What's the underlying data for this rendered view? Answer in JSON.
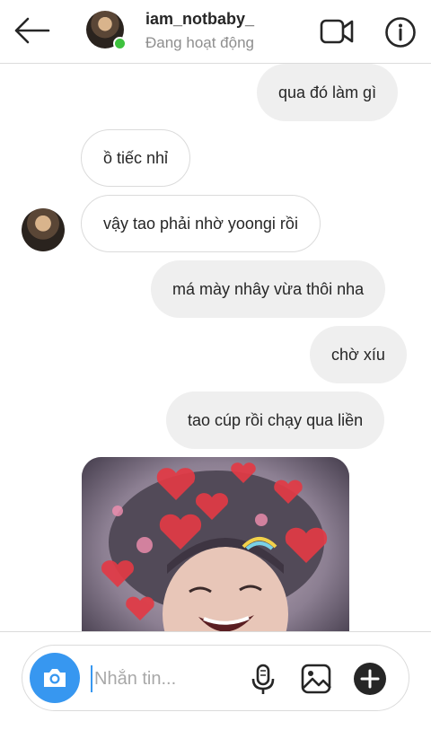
{
  "header": {
    "username": "iam_notbaby_",
    "status": "Đang hoạt động"
  },
  "messages": [
    {
      "side": "sent",
      "text": "qua đó làm gì"
    },
    {
      "side": "received",
      "text": "ồ tiếc nhỉ"
    },
    {
      "side": "received",
      "text": "vậy tao phải nhờ yoongi rồi"
    },
    {
      "side": "sent",
      "text": "má mày nhây vừa thôi nha"
    },
    {
      "side": "sent",
      "text": "chờ xíu"
    },
    {
      "side": "sent",
      "text": "tao cúp rồi chạy qua liền"
    }
  ],
  "composer": {
    "placeholder": "Nhắn tin..."
  },
  "colors": {
    "accent": "#3797f0",
    "online": "#3ec23e",
    "sent_bubble": "#efefef",
    "border": "#dbdbdb",
    "secondary_text": "#8e8e8e"
  },
  "icons": [
    "back-arrow-icon",
    "video-call-icon",
    "info-icon",
    "camera-icon",
    "microphone-icon",
    "gallery-icon",
    "plus-icon"
  ]
}
